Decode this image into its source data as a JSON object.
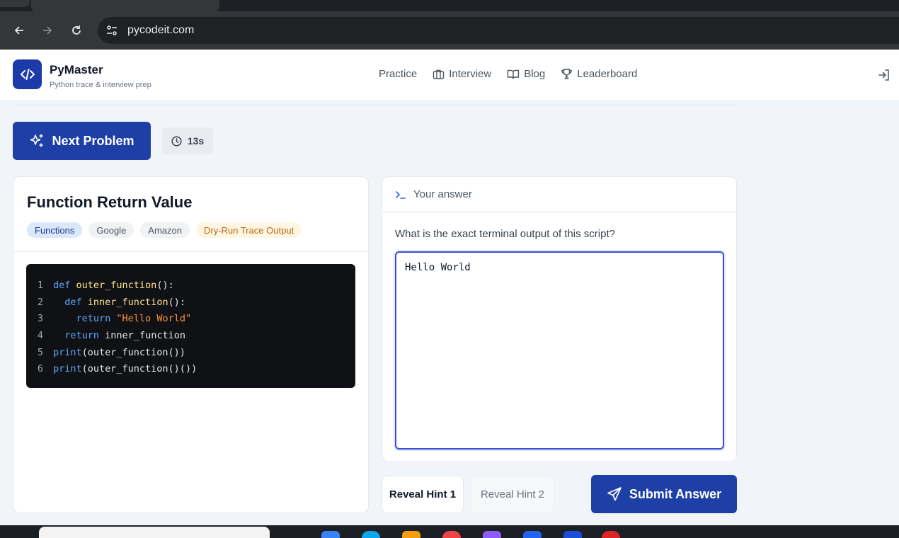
{
  "browser": {
    "url": "pycodeit.com"
  },
  "header": {
    "brand_name": "PyMaster",
    "brand_subtitle": "Python trace & interview prep",
    "nav": [
      {
        "label": "Practice",
        "icon": "none"
      },
      {
        "label": "Interview",
        "icon": "briefcase-icon"
      },
      {
        "label": "Blog",
        "icon": "book-icon"
      },
      {
        "label": "Leaderboard",
        "icon": "trophy-icon"
      }
    ]
  },
  "toolbar": {
    "next_label": "Next Problem",
    "timer": "13s"
  },
  "problem": {
    "title": "Function Return Value",
    "tags": [
      {
        "label": "Functions",
        "style": "blue"
      },
      {
        "label": "Google",
        "style": "gray"
      },
      {
        "label": "Amazon",
        "style": "gray"
      },
      {
        "label": "Dry-Run Trace Output",
        "style": "amber"
      }
    ],
    "code_lines": [
      {
        "n": "1",
        "text": "def outer_function():"
      },
      {
        "n": "2",
        "text": "  def inner_function():"
      },
      {
        "n": "3",
        "text": "    return \"Hello World\""
      },
      {
        "n": "4",
        "text": "  return inner_function"
      },
      {
        "n": "5",
        "text": "print(outer_function())"
      },
      {
        "n": "6",
        "text": "print(outer_function()())"
      }
    ]
  },
  "answer": {
    "header": "Your answer",
    "question": "What is the exact terminal output of this script?",
    "value": "Hello World"
  },
  "actions": {
    "hint1": "Reveal Hint 1",
    "hint2": "Reveal Hint 2",
    "submit": "Submit Answer"
  },
  "colors": {
    "primary": "#1e3fa6",
    "code_bg": "#0f1115",
    "focus_border": "#3b4fd0"
  }
}
